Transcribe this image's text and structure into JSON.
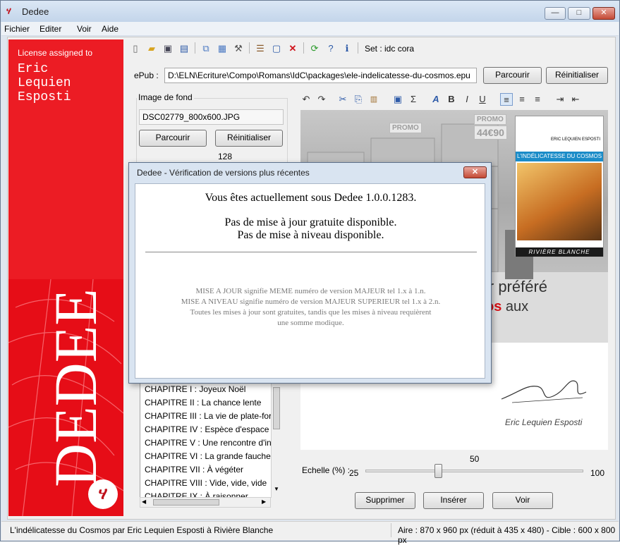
{
  "window": {
    "title": "Dedee",
    "app_icon": "dedee-logo-icon",
    "controls": {
      "minimize": "—",
      "maximize": "□",
      "close": "✕"
    }
  },
  "menu": [
    "Fichier",
    "Editer",
    "Voir",
    "Aide"
  ],
  "license": {
    "label": "License assigned to",
    "name_line1": "Eric",
    "name_line2": "Lequien",
    "name_line3": "Esposti"
  },
  "brand": {
    "big_text": "DEDEE"
  },
  "toolbar": {
    "icons": [
      "new-icon",
      "open-icon",
      "save-icon",
      "save-all-icon",
      "copy-icon",
      "export-icon",
      "tools-icon",
      "list-icon",
      "window-icon",
      "delete-icon",
      "refresh-icon",
      "help-icon",
      "info-icon"
    ],
    "set_label": "Set : idc cora"
  },
  "epub": {
    "label": "ePub :",
    "path": "D:\\ELN\\Ecriture\\Compo\\Romans\\IdC\\packages\\ele-indelicatesse-du-cosmos.epu",
    "browse": "Parcourir",
    "reset": "Réinitialiser"
  },
  "background_image": {
    "group_title": "Image de fond",
    "filename": "DSC02779_800x600.JPG",
    "browse": "Parcourir",
    "reset": "Réinitialiser",
    "value": "128"
  },
  "format_toolbar": {
    "icons": [
      "undo-icon",
      "redo-icon",
      "cut-icon",
      "copy-icon",
      "paste-icon",
      "insert-image-icon",
      "sigma-icon",
      "font-icon",
      "bold-icon",
      "italic-icon",
      "underline-icon",
      "align-left-icon",
      "align-center-icon",
      "align-right-icon",
      "indent-icon",
      "outdent-icon"
    ],
    "glyphs": [
      "↶",
      "↷",
      "✂",
      "⎘",
      "📋",
      "▣",
      "Σ",
      "A",
      "B",
      "I",
      "U",
      "≡",
      "≡",
      "≡",
      "⇥",
      "⇤"
    ]
  },
  "preview": {
    "promo1": "PROMO",
    "promo2": "PROMO",
    "promo_price": "44€90",
    "text_line1": "ir préféré",
    "text_line2_red": "os",
    "text_line2_rest": " aux",
    "cover_publisher": "ERIC LEQUIEN ESPOSTI",
    "cover_title": "L'INDÉLICATESSE DU COSMOS",
    "cover_footer": "RIVIÈRE BLANCHE",
    "signature": "Eric Lequien Esposti"
  },
  "chapters": [
    "CHAPITRE I : Joyeux Noël",
    "CHAPITRE II : La chance lente",
    "CHAPITRE III : La vie de plate-form",
    "CHAPITRE IV : Espèce d'espace",
    "CHAPITRE V : Une rencontre d'inte",
    "CHAPITRE VI : La grande faucheus",
    "CHAPITRE VII : À végéter",
    "CHAPITRE VIII : Vide, vide, vide",
    "CHAPITRE IX : À raisonner"
  ],
  "scale": {
    "label": "Echelle (%) :",
    "min": "25",
    "max": "100",
    "value": "50",
    "fraction": 0.333
  },
  "actions": {
    "delete": "Supprimer",
    "insert": "Insérer",
    "view": "Voir"
  },
  "status": {
    "left": "L'indélicatesse du Cosmos par Eric Lequien Esposti à Rivière Blanche",
    "right": "Aire : 870 x 960 px (réduit à 435 x 480) - Cible : 600 x 800 px"
  },
  "dialog": {
    "title": "Dedee - Vérification de versions plus récentes",
    "close": "✕",
    "version_text": "Vous êtes actuellement sous Dedee 1.0.0.1283.",
    "no_update": "Pas de mise à jour  gratuite disponible.",
    "no_upgrade": "Pas de mise à niveau disponible.",
    "note_line1": "MISE A JOUR signifie MEME numéro de version MAJEUR tel 1.x à 1.n.",
    "note_line2": "MISE A NIVEAU signifie numéro de version MAJEUR SUPERIEUR tel 1.x à 2.n.",
    "note_line3": "Toutes les mises à jour sont gratuites, tandis que les mises à niveau requièrent",
    "note_line4": "une somme modique."
  }
}
